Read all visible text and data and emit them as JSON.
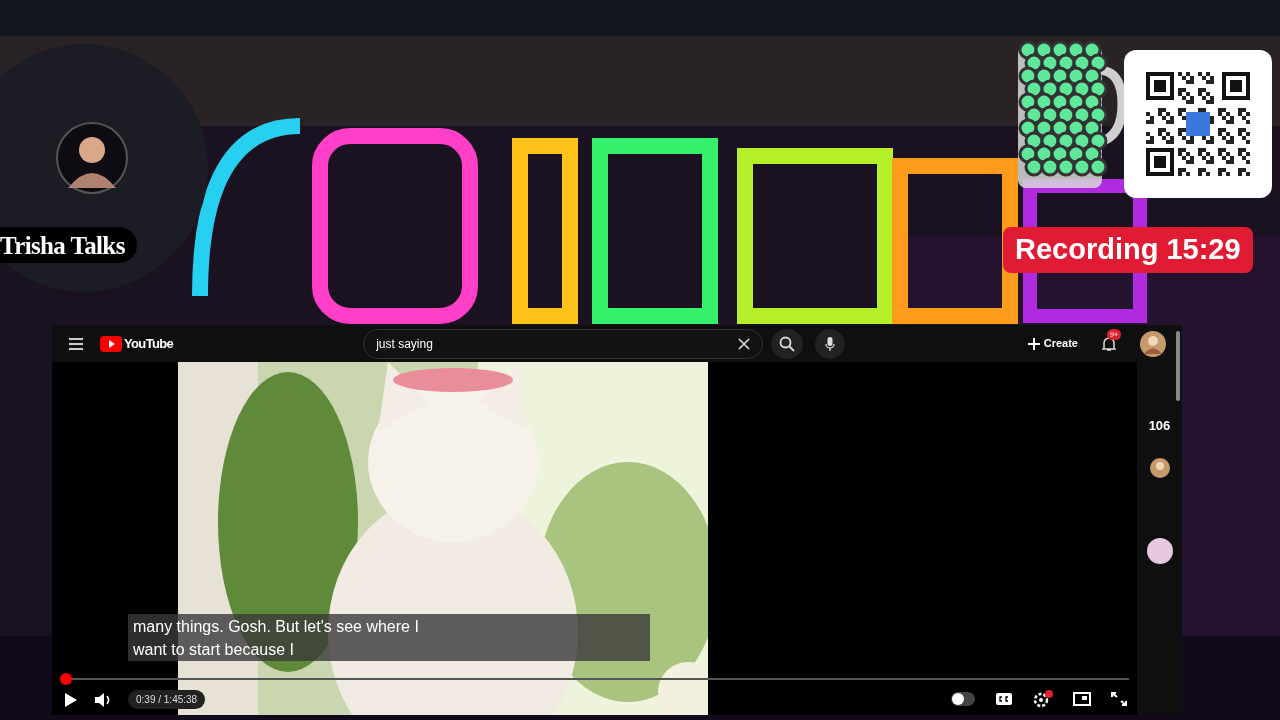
{
  "overlay": {
    "streamer_name": "Trisha Talks",
    "recording": "Recording 15:29"
  },
  "browser": {
    "logo": "YouTube",
    "search": {
      "value": "just saying"
    },
    "create": "Create",
    "notification_count": "9+",
    "player": {
      "captions": [
        "many things. Gosh. But let's see where I",
        "want to start because I"
      ],
      "level": 0.006,
      "time": "0:39 / 1:45:38"
    },
    "side_panel": {
      "count": "106"
    }
  }
}
